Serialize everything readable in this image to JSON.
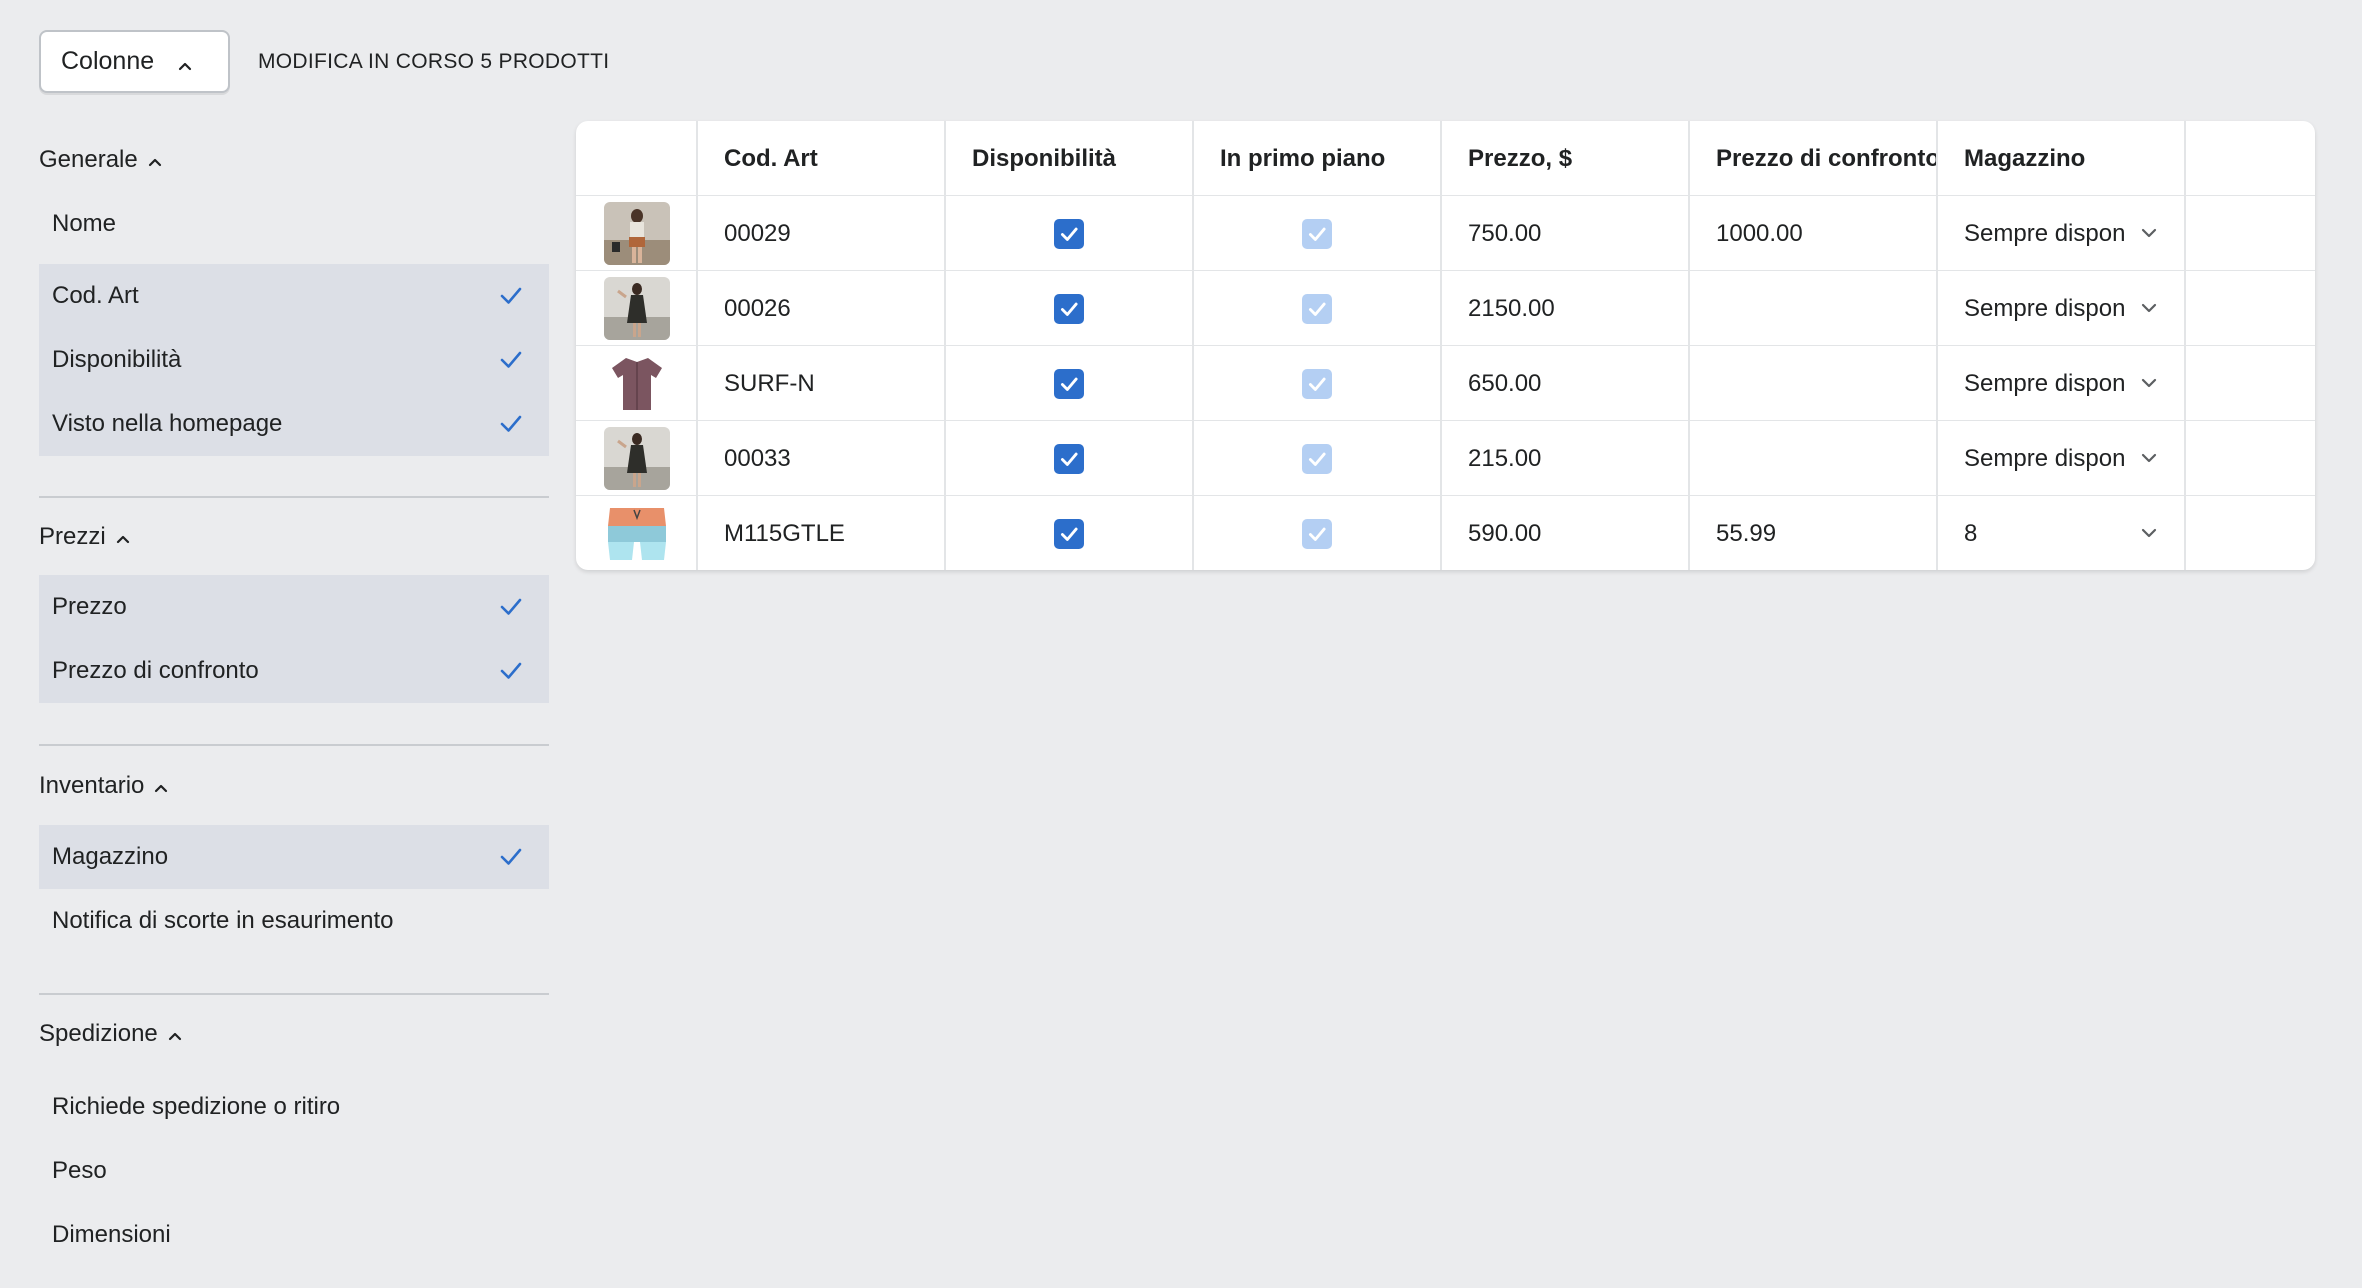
{
  "toolbar": {
    "columns_button": "Colonne",
    "editing_label": "MODIFICA IN CORSO 5 PRODOTTI"
  },
  "sidebar": {
    "sections": [
      {
        "title": "Generale",
        "items": [
          {
            "label": "Nome",
            "selected": false
          },
          {
            "label": "Cod. Art",
            "selected": true
          },
          {
            "label": "Disponibilità",
            "selected": true
          },
          {
            "label": "Visto nella homepage",
            "selected": true
          }
        ]
      },
      {
        "title": "Prezzi",
        "items": [
          {
            "label": "Prezzo",
            "selected": true
          },
          {
            "label": "Prezzo di confronto",
            "selected": true
          }
        ]
      },
      {
        "title": "Inventario",
        "items": [
          {
            "label": "Magazzino",
            "selected": true
          },
          {
            "label": "Notifica di scorte in esaurimento",
            "selected": false
          }
        ]
      },
      {
        "title": "Spedizione",
        "items": [
          {
            "label": "Richiede spedizione o ritiro",
            "selected": false
          },
          {
            "label": "Peso",
            "selected": false
          },
          {
            "label": "Dimensioni",
            "selected": false
          }
        ]
      }
    ]
  },
  "table": {
    "headers": [
      "",
      "Cod. Art",
      "Disponibilità",
      "In primo piano",
      "Prezzo, $",
      "Prezzo di confronto",
      "Magazzino",
      ""
    ],
    "rows": [
      {
        "thumb": "woman-beach",
        "sku": "00029",
        "available": true,
        "featured": true,
        "price": "750.00",
        "compare": "1000.00",
        "stock": "Sempre dispon"
      },
      {
        "thumb": "dress-beach",
        "sku": "00026",
        "available": true,
        "featured": true,
        "price": "2150.00",
        "compare": "",
        "stock": "Sempre dispon"
      },
      {
        "thumb": "shirt",
        "sku": "SURF-N",
        "available": true,
        "featured": true,
        "price": "650.00",
        "compare": "",
        "stock": "Sempre dispon"
      },
      {
        "thumb": "dress-beach",
        "sku": "00033",
        "available": true,
        "featured": true,
        "price": "215.00",
        "compare": "",
        "stock": "Sempre dispon"
      },
      {
        "thumb": "swim-shorts",
        "sku": "M115GTLE",
        "available": true,
        "featured": true,
        "price": "590.00",
        "compare": "55.99",
        "stock": "8"
      }
    ]
  },
  "colors": {
    "accent": "#2c6ecb",
    "accent_dim": "#b4cff3",
    "selected_bg": "#dcdfe6",
    "page_bg": "#ebecee"
  }
}
